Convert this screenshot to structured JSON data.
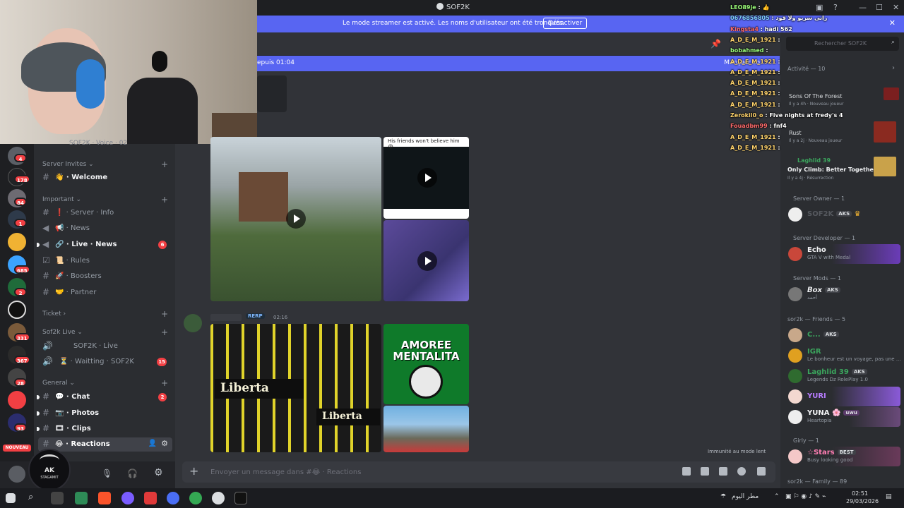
{
  "app": {
    "title": "SOF2K",
    "window_controls": [
      "—",
      "☐",
      "✕"
    ]
  },
  "banner": {
    "text": "Le mode streamer est activé. Les noms d'utilisateur ont été tronqués.",
    "button": "Désactiver",
    "close": "✕"
  },
  "new_messages": {
    "left": "epuis 01:04",
    "right": "Marquer co"
  },
  "server_rail": {
    "badges": [
      "4",
      "178",
      "84",
      "1",
      "685",
      "2",
      "331",
      "367",
      "28",
      "93"
    ],
    "nouveau": "NOUVEAU"
  },
  "channels": {
    "top_partial": "SOF2K · Voice · 02",
    "categories": [
      {
        "label": "Server Invites ⌄"
      },
      {
        "label": "Important ⌄"
      },
      {
        "label": "Ticket ›"
      },
      {
        "label": "Sof2k Live ⌄"
      },
      {
        "label": "General ⌄"
      }
    ],
    "items": [
      {
        "label": "👋 · Welcome"
      },
      {
        "label": "❗ · Server · Info"
      },
      {
        "label": "📢 · News"
      },
      {
        "label": "🔗 · Live · News",
        "badge": "6"
      },
      {
        "label": "📜 · Rules"
      },
      {
        "label": "🚀 · Boosters"
      },
      {
        "label": "🤝 · Partner"
      },
      {
        "label": "SOF2K · Live"
      },
      {
        "label": "⏳ · Waitting · SOF2K",
        "badge": "15"
      },
      {
        "label": "💬 · Chat",
        "badge": "2"
      },
      {
        "label": "📷 · Photos"
      },
      {
        "label": "🎞 · Clips"
      },
      {
        "label": "😂 · Reactions"
      }
    ]
  },
  "user_panel": {
    "logo_text": "AK",
    "logo_sub": "STAGAMIT"
  },
  "chat": {
    "video_caption": "His friends won't believe him 😭",
    "message2": {
      "badge": "RERP",
      "time": "02:16"
    },
    "image_texts": [
      "Liberta",
      "AMOREE MENTALITA",
      "Liberta"
    ],
    "immunity": "Immunité au mode lent",
    "composer_placeholder": "Envoyer un message dans #😂 · Reactions"
  },
  "members": {
    "search_placeholder": "Rechercher SOF2K",
    "activity_label": "Activité — 10",
    "activities": [
      {
        "title": "Sons Of The Forest",
        "status": "Il y a 4h · Nouveau joueur"
      },
      {
        "title": "Rust",
        "status": "Il y a 2j · Nouveau joueur"
      },
      {
        "title": "Only Climb: Better Together",
        "status": "Il y a 4j · Résurrection",
        "name": "Laghlid 39"
      }
    ],
    "sections": [
      {
        "label": "Server Owner — 1"
      },
      {
        "label": "Server Developer — 1"
      },
      {
        "label": "Server Mods — 1"
      },
      {
        "label": "sor2k — Friends — 5"
      },
      {
        "label": "Girly — 1"
      },
      {
        "label": "sor2k — Family — 89"
      }
    ],
    "list": [
      {
        "name": "SOF2K",
        "tag": "AKS",
        "status": ""
      },
      {
        "name": "Echo",
        "tag": "",
        "status": "GTA V with Medal"
      },
      {
        "name": "𝘽𝙤𝙭",
        "tag": "AKS",
        "status": "أحمد"
      },
      {
        "name": "C...",
        "tag": "AKS",
        "status": ""
      },
      {
        "name": "IGR",
        "tag": "",
        "status": "Le bonheur est un voyage, pas une ..."
      },
      {
        "name": "Laghlid 39",
        "tag": "AKS",
        "status": "Legends Dz RolePlay 1.0"
      },
      {
        "name": "YURI",
        "tag": "",
        "status": ""
      },
      {
        "name": "YUNA 🌸",
        "tag": "uwu",
        "status": "Heartopia"
      },
      {
        "name": "☆Stars",
        "tag": "BEST",
        "status": "Busy looking good"
      }
    ]
  },
  "twitch_chat": [
    {
      "user": "LEO89je",
      "msg": "👍",
      "color": "#9cff7a"
    },
    {
      "user": "0676856805",
      "msg": "رانى سريو ولا قود",
      "color": "#7fd0ff"
    },
    {
      "user": "Kingsta4",
      "msg": "hadi 562",
      "color": "#ff6b6b"
    },
    {
      "user": "A_D_E_M_1921",
      "msg": "",
      "color": "#ffd36b"
    },
    {
      "user": "bobahmed",
      "msg": "",
      "color": "#9cff7a"
    },
    {
      "user": "A_D_E_M_1921",
      "msg": "",
      "color": "#ffd36b"
    },
    {
      "user": "A_D_E_M_1921",
      "msg": "",
      "color": "#ffd36b"
    },
    {
      "user": "A_D_E_M_1921",
      "msg": "",
      "color": "#ffd36b"
    },
    {
      "user": "A_D_E_M_1921",
      "msg": "",
      "color": "#ffd36b"
    },
    {
      "user": "A_D_E_M_1921",
      "msg": "",
      "color": "#ffd36b"
    },
    {
      "user": "Zerokil0_o",
      "msg": "Five nights at fredy's 4",
      "color": "#ffd36b"
    },
    {
      "user": "Fouadbm99",
      "msg": "fnf4",
      "color": "#ff6b6b"
    },
    {
      "user": "A_D_E_M_1921",
      "msg": "",
      "color": "#ffd36b"
    },
    {
      "user": "A_D_E_M_1921",
      "msg": "",
      "color": "#ffd36b"
    }
  ],
  "taskbar": {
    "weather": "مطر اليوم",
    "time": "02:51",
    "date": "29/03/2026"
  }
}
